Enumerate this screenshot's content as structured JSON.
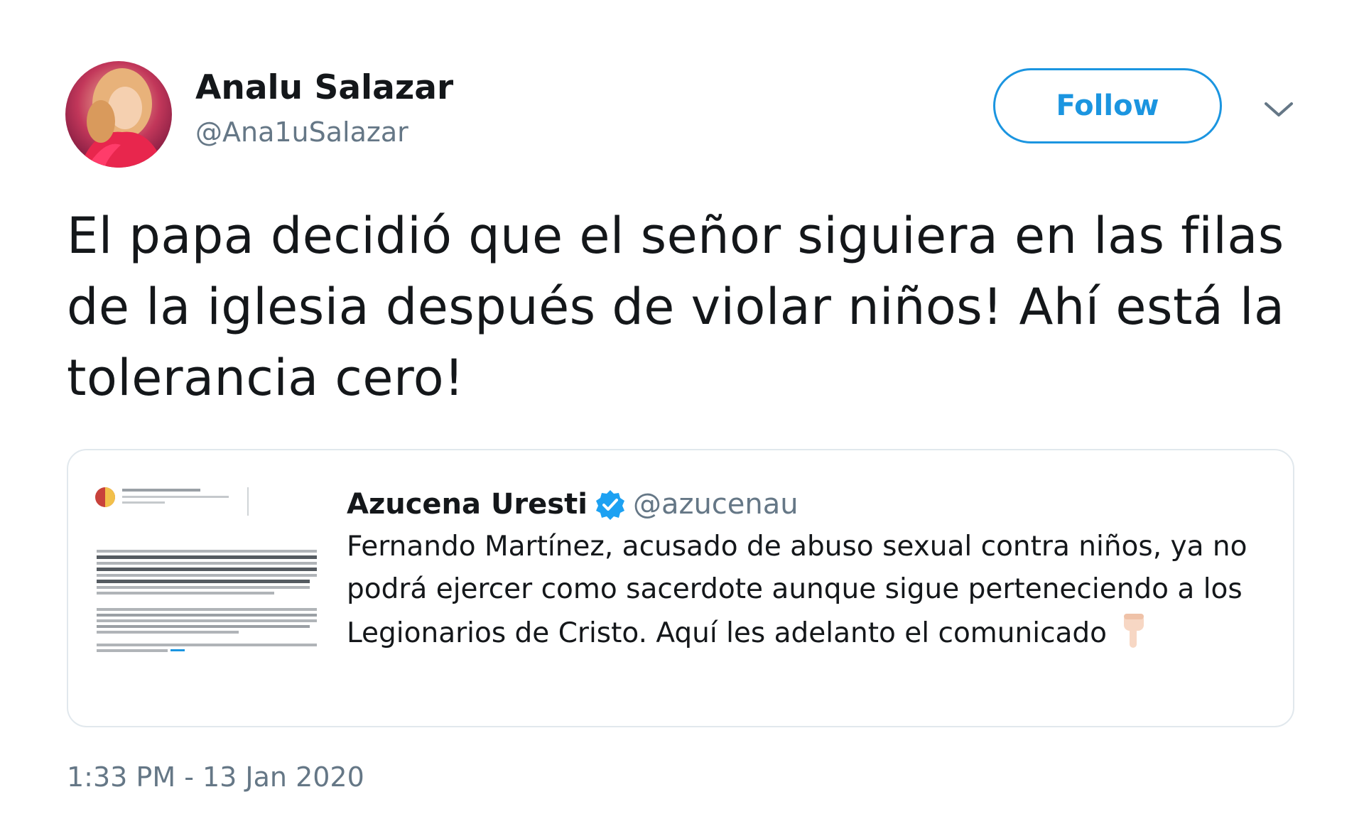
{
  "author": {
    "display_name": "Analu Salazar",
    "handle": "@Ana1uSalazar",
    "avatar_icon": "profile-photo"
  },
  "follow_label": "Follow",
  "menu_icon": "chevron-down-icon",
  "tweet_text": "El papa decidió que el señor siguiera en las filas de la iglesia después de violar niños! Ahí está la tolerancia cero!",
  "quoted": {
    "display_name": "Azucena Uresti",
    "handle": "@azucenau",
    "verified": true,
    "text": "Fernando Martínez, acusado de abuso sexual contra niños, ya no podrá ejercer como sacerdote aunque sigue perteneciendo a los Legionarios de Cristo. Aquí les adelanto el comunicado",
    "emoji_icon": "pointing-down-hand-icon",
    "thumbnail_icon": "document-thumbnail"
  },
  "timestamp": "1:33 PM - 13 Jan 2020",
  "colors": {
    "accent": "#1b95e0",
    "secondary_text": "#657786",
    "border": "#e1e8ed"
  }
}
